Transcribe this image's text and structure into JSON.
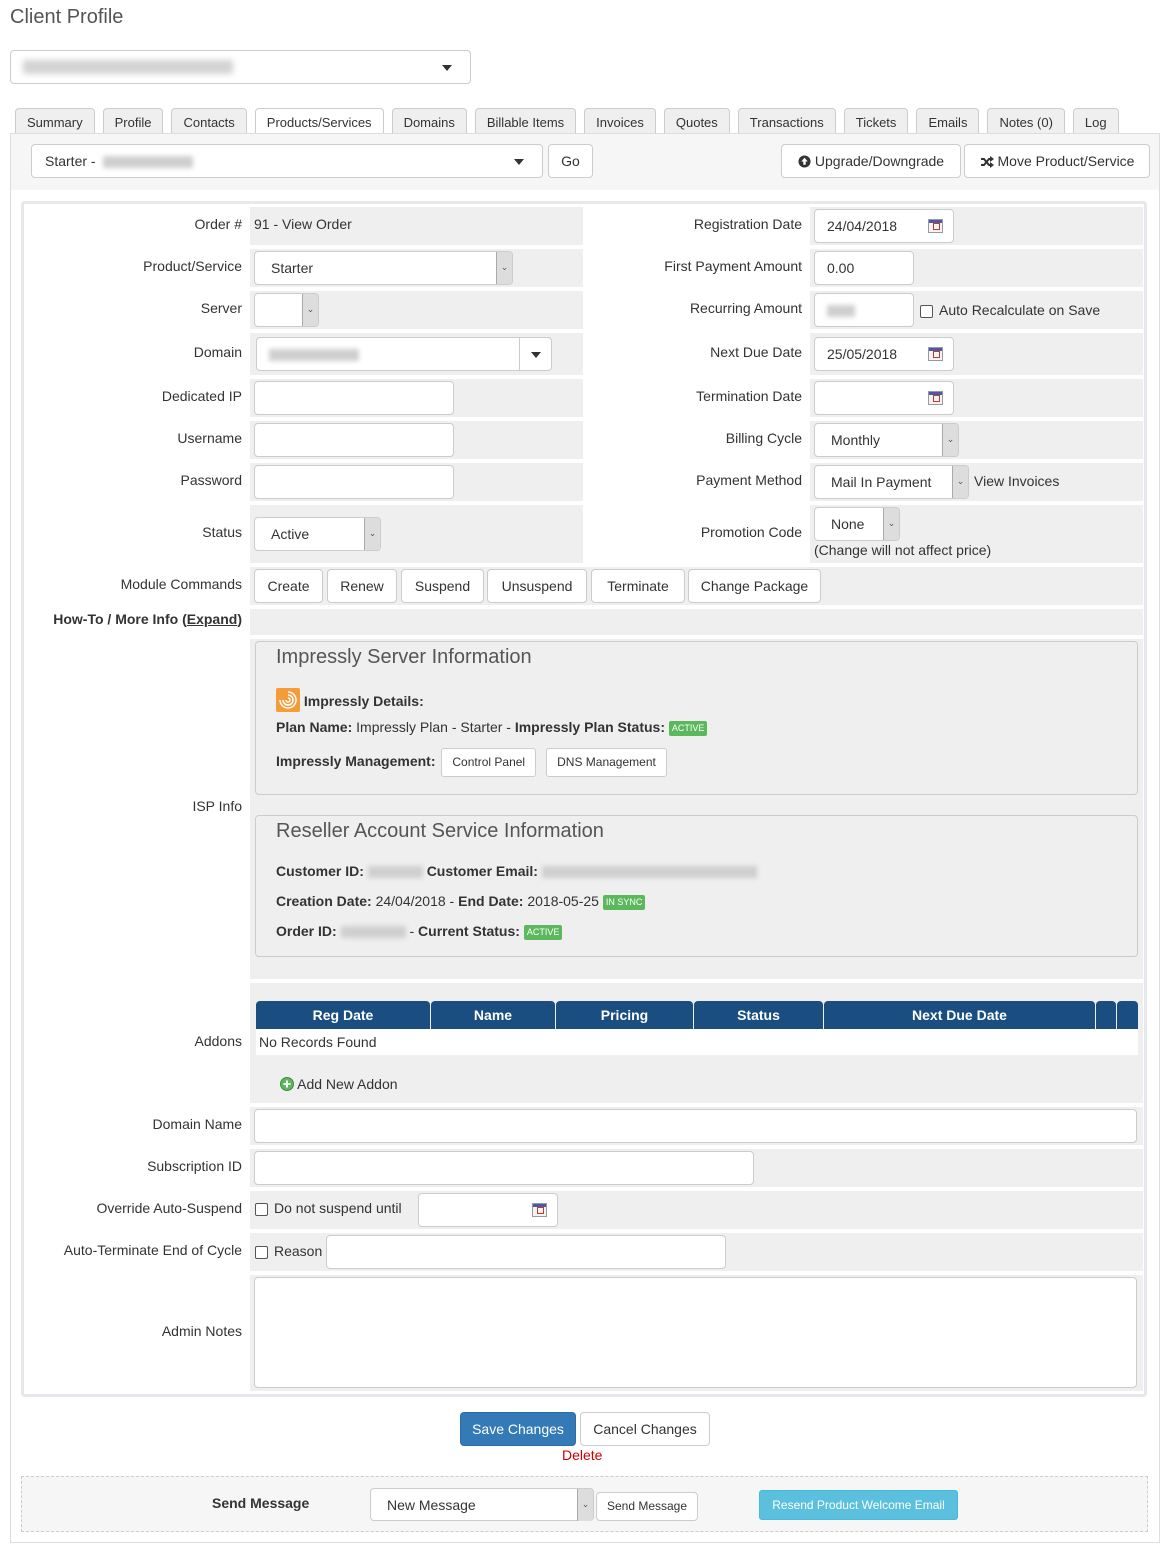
{
  "page": {
    "title": "Client Profile"
  },
  "client_selector": {
    "value": "Marco Ferraro (Not Applicable) - #1 (redacted)"
  },
  "tabs": [
    {
      "label": "Summary",
      "active": false
    },
    {
      "label": "Profile",
      "active": false
    },
    {
      "label": "Contacts",
      "active": false
    },
    {
      "label": "Products/Services",
      "active": true
    },
    {
      "label": "Domains",
      "active": false
    },
    {
      "label": "Billable Items",
      "active": false
    },
    {
      "label": "Invoices",
      "active": false
    },
    {
      "label": "Quotes",
      "active": false
    },
    {
      "label": "Transactions",
      "active": false
    },
    {
      "label": "Tickets",
      "active": false
    },
    {
      "label": "Emails",
      "active": false
    },
    {
      "label": "Notes (0)",
      "active": false
    },
    {
      "label": "Log",
      "active": false
    }
  ],
  "toolbar": {
    "service_select_prefix": "Starter - ",
    "go_label": "Go",
    "upgrade_label": "Upgrade/Downgrade",
    "move_label": "Move Product/Service"
  },
  "form": {
    "order_label": "Order #",
    "order_value": "91 - View Order",
    "product_label": "Product/Service",
    "product_value": "Starter",
    "server_label": "Server",
    "server_value": "",
    "domain_label": "Domain",
    "dedicated_ip_label": "Dedicated IP",
    "dedicated_ip_value": "",
    "username_label": "Username",
    "username_value": "",
    "password_label": "Password",
    "password_value": "",
    "status_label": "Status",
    "status_value": "Active",
    "registration_date_label": "Registration Date",
    "registration_date_value": "24/04/2018",
    "first_payment_label": "First Payment Amount",
    "first_payment_value": "0.00",
    "recurring_label": "Recurring Amount",
    "auto_recalc_label": "Auto Recalculate on Save",
    "next_due_label": "Next Due Date",
    "next_due_value": "25/05/2018",
    "termination_label": "Termination Date",
    "termination_value": "",
    "billing_cycle_label": "Billing Cycle",
    "billing_cycle_value": "Monthly",
    "payment_method_label": "Payment Method",
    "payment_method_value": "Mail In Payment",
    "view_invoices_label": "View Invoices",
    "promo_label": "Promotion Code",
    "promo_value": "None",
    "promo_note": "(Change will not affect price)",
    "module_commands_label": "Module Commands",
    "module_commands": [
      "Create",
      "Renew",
      "Suspend",
      "Unsuspend",
      "Terminate",
      "Change Package"
    ],
    "howto_label": "How-To / More Info (",
    "howto_expand": "Expand",
    "howto_close": ")",
    "isp_info_label": "ISP Info",
    "addons_label": "Addons",
    "domain_name_label": "Domain Name",
    "domain_name_value": "",
    "subscription_id_label": "Subscription ID",
    "subscription_id_value": "",
    "override_suspend_label": "Override Auto-Suspend",
    "do_not_suspend_label": "Do not suspend until",
    "auto_terminate_label": "Auto-Terminate End of Cycle",
    "reason_label": "Reason",
    "admin_notes_label": "Admin Notes",
    "admin_notes_value": ""
  },
  "impressly": {
    "title": "Impressly Server Information",
    "details_label": "Impressly Details:",
    "plan_name_label": "Plan Name:",
    "plan_name_value": "Impressly Plan - Starter - ",
    "plan_status_label": "Impressly Plan Status:",
    "plan_status_badge": "ACTIVE",
    "management_label": "Impressly Management:",
    "control_panel_label": "Control Panel",
    "dns_label": "DNS Management"
  },
  "reseller": {
    "title": "Reseller Account Service Information",
    "customer_id_label": "Customer ID:",
    "customer_email_label": "Customer Email:",
    "creation_date_label": "Creation Date:",
    "creation_date_value": "24/04/2018",
    "end_date_label": "End Date:",
    "end_date_value": "2018-05-25",
    "sync_badge": "IN SYNC",
    "order_id_label": "Order ID:",
    "current_status_label": "Current Status:",
    "status_badge": "ACTIVE",
    "separator": " - "
  },
  "addons": {
    "columns": [
      "Reg Date",
      "Name",
      "Pricing",
      "Status",
      "Next Due Date",
      "",
      ""
    ],
    "empty_text": "No Records Found",
    "add_label": "Add New Addon"
  },
  "actions": {
    "save_label": "Save Changes",
    "cancel_label": "Cancel Changes",
    "delete_label": "Delete"
  },
  "send_message": {
    "label": "Send Message",
    "select_value": "New Message",
    "send_button": "Send Message",
    "resend_button": "Resend Product Welcome Email"
  },
  "colors": {
    "primary": "#337ab7",
    "table_header": "#1a4d80",
    "success_badge": "#5cb85c",
    "info_button": "#5bc0de",
    "danger_link": "#cc0000"
  }
}
